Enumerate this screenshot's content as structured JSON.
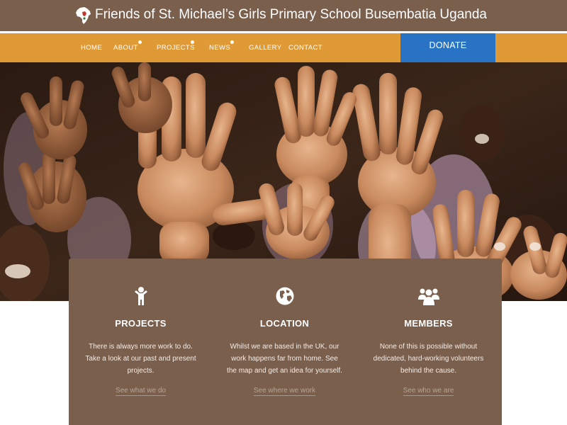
{
  "header": {
    "title": "Friends of St. Michael’s Girls Primary School Busembatia Uganda"
  },
  "nav": {
    "items": [
      {
        "label": "HOME",
        "has_submenu": false
      },
      {
        "label": "ABOUT",
        "has_submenu": true
      },
      {
        "label": "PROJECTS",
        "has_submenu": true
      },
      {
        "label": "NEWS",
        "has_submenu": true
      },
      {
        "label": "GALLERY",
        "has_submenu": false
      },
      {
        "label": "CONTACT",
        "has_submenu": false
      }
    ],
    "donate_label": "DONATE"
  },
  "features": [
    {
      "icon": "child-icon",
      "title": "PROJECTS",
      "text": "There is always more work to do. Take a look at our past and present projects.",
      "link": "See what we do"
    },
    {
      "icon": "globe-icon",
      "title": "LOCATION",
      "text": "Whilst we are based in the UK, our work happens far from home. See the map and get an idea for yourself.",
      "link": "See where we work"
    },
    {
      "icon": "group-icon",
      "title": "MEMBERS",
      "text": "None of this is possible without dedicated, hard-working volunteers behind the cause.",
      "link": "See who we are"
    }
  ],
  "colors": {
    "brand_brown": "#7a5f4d",
    "nav_orange": "#e09a35",
    "donate_blue": "#2873c4"
  }
}
